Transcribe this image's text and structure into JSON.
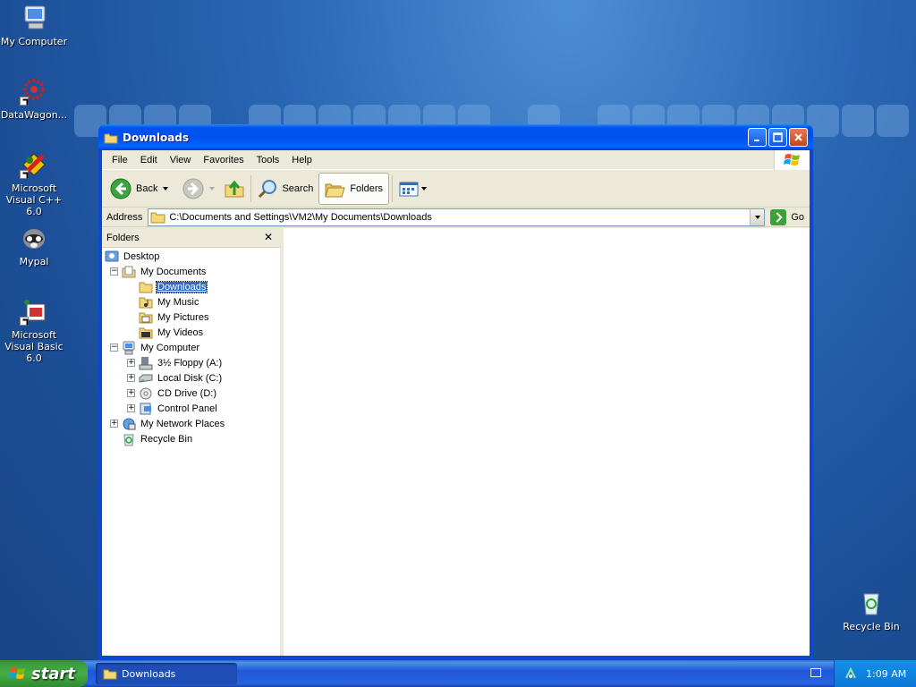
{
  "desktop": {
    "icons": [
      {
        "label": "My Computer",
        "icon": "my-computer-icon"
      },
      {
        "label": "DataWagon...",
        "icon": "datawagon-icon"
      },
      {
        "label": "Microsoft Visual C++ 6.0",
        "icon": "visual-cpp-icon"
      },
      {
        "label": "Mypal",
        "icon": "mypal-icon"
      },
      {
        "label": "Microsoft Visual Basic 6.0",
        "icon": "visual-basic-icon"
      },
      {
        "label": "Recycle Bin",
        "icon": "recycle-bin-icon"
      }
    ]
  },
  "window": {
    "title": "Downloads",
    "menu": [
      "File",
      "Edit",
      "View",
      "Favorites",
      "Tools",
      "Help"
    ],
    "toolbar": {
      "back": "Back",
      "search": "Search",
      "folders": "Folders"
    },
    "address": {
      "label": "Address",
      "value": "C:\\Documents and Settings\\VM2\\My Documents\\Downloads",
      "go": "Go"
    },
    "folders_pane": {
      "title": "Folders",
      "tree": [
        {
          "label": "Desktop",
          "icon": "desktop-icon"
        },
        {
          "label": "My Documents",
          "icon": "my-documents-icon",
          "expander": "−"
        },
        {
          "label": "Downloads",
          "icon": "folder-icon",
          "selected": true
        },
        {
          "label": "My Music",
          "icon": "my-music-icon"
        },
        {
          "label": "My Pictures",
          "icon": "my-pictures-icon"
        },
        {
          "label": "My Videos",
          "icon": "my-videos-icon"
        },
        {
          "label": "My Computer",
          "icon": "my-computer-icon",
          "expander": "−"
        },
        {
          "label": "3½ Floppy (A:)",
          "icon": "floppy-icon",
          "expander": "+"
        },
        {
          "label": "Local Disk (C:)",
          "icon": "hard-disk-icon",
          "expander": "+"
        },
        {
          "label": "CD Drive (D:)",
          "icon": "cd-drive-icon",
          "expander": "+"
        },
        {
          "label": "Control Panel",
          "icon": "control-panel-icon",
          "expander": "+"
        },
        {
          "label": "My Network Places",
          "icon": "network-places-icon",
          "expander": "+"
        },
        {
          "label": "Recycle Bin",
          "icon": "recycle-bin-icon"
        }
      ]
    }
  },
  "taskbar": {
    "start": "start",
    "task": "Downloads",
    "clock": "1:09 AM"
  }
}
